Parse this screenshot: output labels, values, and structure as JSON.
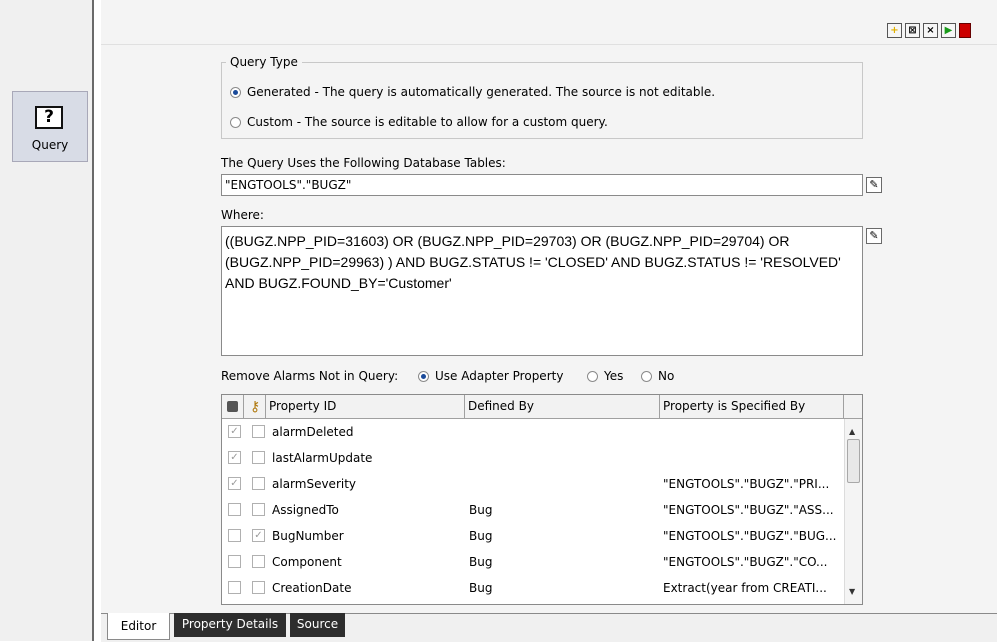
{
  "sidebar": {
    "query_label": "Query",
    "query_icon": "question-mark-icon"
  },
  "toolbar": {
    "buttons": [
      {
        "name": "new-icon",
        "glyph": "+",
        "color": "#e0b000"
      },
      {
        "name": "delete-icon",
        "glyph": "⊠",
        "color": "#333333"
      },
      {
        "name": "close-icon",
        "glyph": "×",
        "color": "#000000"
      },
      {
        "name": "run-icon",
        "glyph": "▶",
        "color": "#1a9a1a"
      },
      {
        "name": "stop-icon",
        "glyph": "■",
        "color": "#cc0000"
      }
    ]
  },
  "query_type": {
    "legend": "Query Type",
    "generated_label": "Generated - The query is automatically generated. The source is not editable.",
    "custom_label": "Custom - The source is editable to allow for a custom query.",
    "selected": "generated"
  },
  "tables_field": {
    "label": "The Query Uses the Following Database Tables:",
    "value": "\"ENGTOOLS\".\"BUGZ\""
  },
  "where_field": {
    "label": "Where:",
    "value": "((BUGZ.NPP_PID=31603) OR (BUGZ.NPP_PID=29703) OR (BUGZ.NPP_PID=29704) OR (BUGZ.NPP_PID=29963) ) AND  BUGZ.STATUS != 'CLOSED'  AND BUGZ.STATUS != 'RESOLVED' AND BUGZ.FOUND_BY='Customer'"
  },
  "remove_alarms": {
    "label": "Remove Alarms Not in Query:",
    "options": [
      "Use Adapter Property",
      "Yes",
      "No"
    ],
    "selected": "Use Adapter Property"
  },
  "property_table": {
    "header_icons": [
      "lock-icon",
      "key-icon"
    ],
    "columns": [
      "Property ID",
      "Defined By",
      "Property is Specified By"
    ],
    "rows": [
      {
        "locked": true,
        "key": false,
        "id": "alarmDeleted",
        "defined_by": "",
        "specified_by": ""
      },
      {
        "locked": true,
        "key": false,
        "id": "lastAlarmUpdate",
        "defined_by": "",
        "specified_by": ""
      },
      {
        "locked": true,
        "key": false,
        "id": "alarmSeverity",
        "defined_by": "",
        "specified_by": "\"ENGTOOLS\".\"BUGZ\".\"PRI..."
      },
      {
        "locked": false,
        "key": false,
        "id": "AssignedTo",
        "defined_by": "Bug",
        "specified_by": "\"ENGTOOLS\".\"BUGZ\".\"ASS..."
      },
      {
        "locked": false,
        "key": true,
        "id": "BugNumber",
        "defined_by": "Bug",
        "specified_by": "\"ENGTOOLS\".\"BUGZ\".\"BUG..."
      },
      {
        "locked": false,
        "key": false,
        "id": "Component",
        "defined_by": "Bug",
        "specified_by": "\"ENGTOOLS\".\"BUGZ\".\"CO..."
      },
      {
        "locked": false,
        "key": false,
        "id": "CreationDate",
        "defined_by": "Bug",
        "specified_by": "Extract(year from CREATI..."
      }
    ]
  },
  "tabs": [
    {
      "label": "Editor",
      "active": true
    },
    {
      "label": "Property Details",
      "active": false
    },
    {
      "label": "Source",
      "active": false
    }
  ]
}
